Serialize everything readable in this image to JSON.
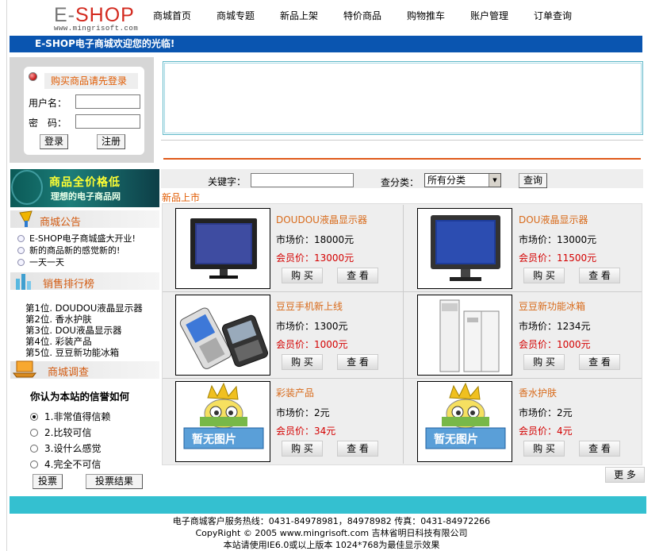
{
  "logo": {
    "brand_e": "E-",
    "brand_shop": "SHOP",
    "sub": "www.mingrisoft.com"
  },
  "nav": [
    "商城首页",
    "商城专题",
    "新品上架",
    "特价商品",
    "购物推车",
    "账户管理",
    "订单查询"
  ],
  "welcome": "E-SHOP电子商城欢迎您的光临!",
  "login": {
    "title": "购买商品请先登录",
    "user_label": "用户名：",
    "pass_label": "密　码：",
    "login_btn": "登录",
    "register_btn": "注册"
  },
  "banner": {
    "line1": "商品全价格低",
    "line2": "理想的电子商品网"
  },
  "notice": {
    "title": "商城公告",
    "items": [
      "E-SHOP电子商城盛大开业!",
      "新的商品新的感觉新的!",
      "一天一天"
    ]
  },
  "ranking": {
    "title": "销售排行榜",
    "items": [
      "第1位. DOUDOU液晶显示器",
      "第2位. 香水护肤",
      "第3位. DOU液晶显示器",
      "第4位. 彩装产品",
      "第5位. 豆豆新功能冰箱"
    ]
  },
  "survey": {
    "title": "商城调查",
    "question": "你认为本站的信誉如何",
    "options": [
      "1.非常值得信赖",
      "2.比较可信",
      "3.设什么感觉",
      "4.完全不可信"
    ],
    "selected": 0,
    "vote_btn": "投票",
    "result_btn": "投票结果"
  },
  "search": {
    "keyword_label": "关键字：",
    "category_label": "查分类：",
    "category_value": "所有分类",
    "query_btn": "查询"
  },
  "new_products_title": "新品上市",
  "products": [
    {
      "name": "DOUDOU液晶显示器",
      "market": "市场价：18000元",
      "member": "会员价：13000元",
      "buy": "购 买",
      "view": "查 看"
    },
    {
      "name": "DOU液晶显示器",
      "market": "市场价：13000元",
      "member": "会员价：11500元",
      "buy": "购 买",
      "view": "查 看"
    },
    {
      "name": "豆豆手机新上线",
      "market": "市场价：1300元",
      "member": "会员价：1000元",
      "buy": "购 买",
      "view": "查 看"
    },
    {
      "name": "豆豆新功能冰箱",
      "market": "市场价：1234元",
      "member": "会员价：1000元",
      "buy": "购 买",
      "view": "查 看"
    },
    {
      "name": "彩装产品",
      "market": "市场价：2元",
      "member": "会员价：34元",
      "buy": "购 买",
      "view": "查 看"
    },
    {
      "name": "香水护肤",
      "market": "市场价：2元",
      "member": "会员价：4元",
      "buy": "购 买",
      "view": "查 看"
    }
  ],
  "no_image_text": "暂无图片",
  "more_btn": "更 多",
  "footer": {
    "line1": "电子商城客户服务热线：0431-84978981，84978982 传真：0431-84972266",
    "line2": "CopyRight © 2005 www.mingrisoft.com 吉林省明日科技有限公司",
    "line3": "本站请使用IE6.0或以上版本 1024*768为最佳显示效果"
  }
}
